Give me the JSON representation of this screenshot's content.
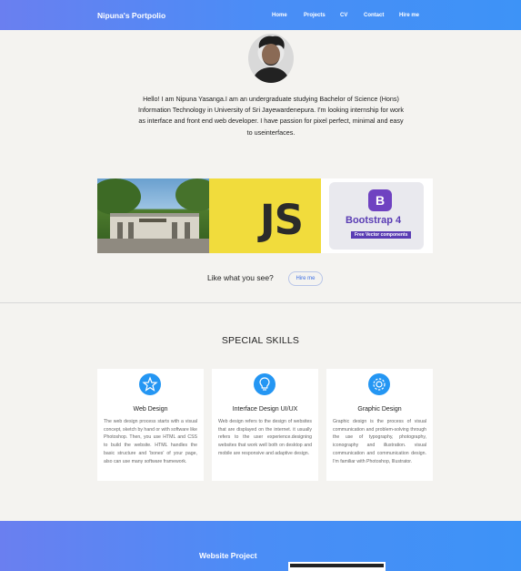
{
  "nav": {
    "brand": "Nipuna's Portpolio",
    "links": [
      "Home",
      "Projects",
      "CV",
      "Contact",
      "Hire me"
    ]
  },
  "hero": {
    "intro": "Hello! I am Nipuna Yasanga.I am an undergraduate studying Bachelor of Science (Hons) Information Technology in University of Sri Jayewardenepura. I'm looking internship for work as interface and front end web developer. I have passion for pixel perfect, minimal and easy to useinterfaces."
  },
  "gallery": {
    "js_text": "JS",
    "bootstrap_title": "Bootstrap 4",
    "bootstrap_sub": "Free Vector components",
    "bootstrap_logo": "B"
  },
  "cta": {
    "text": "Like what you see?",
    "button": "Hire me"
  },
  "skills": {
    "heading": "SPECIAL SKILLS",
    "cards": [
      {
        "icon": "star-icon",
        "title": "Web Design",
        "text": "The web design process starts with a visual concept, sketch by hand or with software like Photoshop. Then, you use HTML and CSS to build the website. HTML handles the basic structure and 'bones' of your page, also can use many software framework."
      },
      {
        "icon": "lightbulb-icon",
        "title": "Interface Design UI/UX",
        "text": "Web design refers to the design of websites that are displayed on the internet. it usually refers to the user experience.designing websites that work well both on desktop and mobile are responsive and adaptive design."
      },
      {
        "icon": "gear-icon",
        "title": "Graphic Design",
        "text": "Graphic design is the process of visual communication and problem-solving through the use of typography, photography, iconography and illustration. visual communication and communication design. I'm familiar with Photoshop, Illustrator."
      }
    ]
  },
  "project": {
    "title": "Website Project"
  },
  "colors": {
    "nav_gradient_start": "#6a7ff0",
    "nav_gradient_end": "#3d93f7",
    "accent_blue": "#2496f3",
    "js_yellow": "#f1dc3c",
    "bootstrap_purple": "#6f42c1"
  }
}
